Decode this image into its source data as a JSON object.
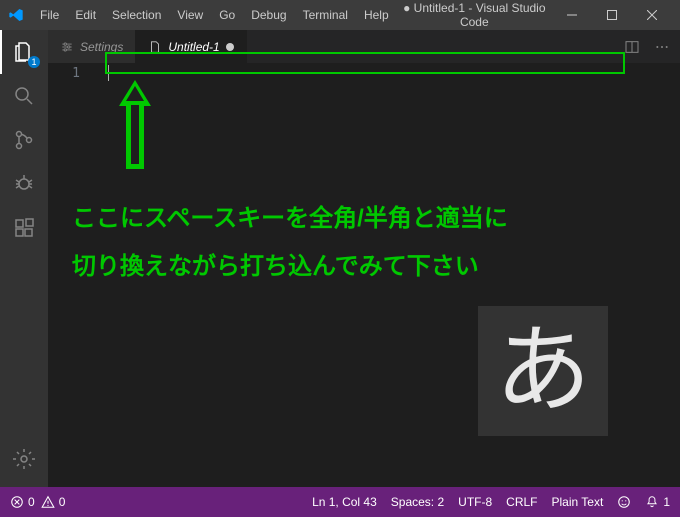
{
  "titlebar": {
    "menus": [
      "File",
      "Edit",
      "Selection",
      "View",
      "Go",
      "Debug",
      "Terminal",
      "Help"
    ],
    "title": "● Untitled-1 - Visual Studio Code"
  },
  "activitybar": {
    "explorer_badge": "1"
  },
  "tabs": {
    "settings": "Settings",
    "untitled": "Untitled-1"
  },
  "editor": {
    "line1": "1"
  },
  "annotation": {
    "line1": "ここにスペースキーを全角/半角と適当に",
    "line2": "切り換えながら打ち込んでみて下さい"
  },
  "ime": {
    "char": "あ"
  },
  "statusbar": {
    "errors": "0",
    "warnings": "0",
    "lncol": "Ln 1, Col 43",
    "spaces": "Spaces: 2",
    "encoding": "UTF-8",
    "eol": "CRLF",
    "lang": "Plain Text",
    "notifications": "1"
  }
}
